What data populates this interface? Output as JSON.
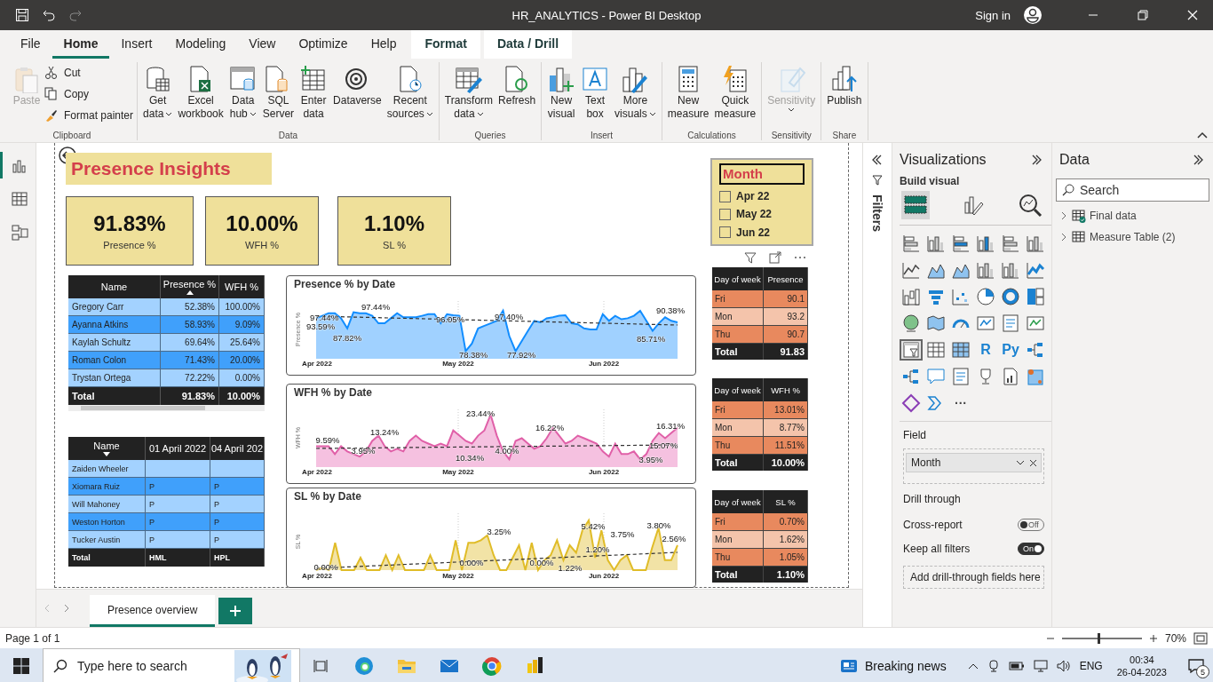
{
  "window": {
    "title": "HR_ANALYTICS - Power BI Desktop",
    "sign_in": "Sign in"
  },
  "menu_tabs": [
    {
      "label": "File",
      "selected": false,
      "contextual": false
    },
    {
      "label": "Home",
      "selected": true,
      "contextual": false
    },
    {
      "label": "Insert",
      "selected": false,
      "contextual": false
    },
    {
      "label": "Modeling",
      "selected": false,
      "contextual": false
    },
    {
      "label": "View",
      "selected": false,
      "contextual": false
    },
    {
      "label": "Optimize",
      "selected": false,
      "contextual": false
    },
    {
      "label": "Help",
      "selected": false,
      "contextual": false
    },
    {
      "label": "Format",
      "selected": false,
      "contextual": true
    },
    {
      "label": "Data / Drill",
      "selected": false,
      "contextual": true
    }
  ],
  "ribbon_groups": [
    {
      "name": "Clipboard",
      "items": [
        {
          "kind": "large",
          "lines": [
            "Paste"
          ],
          "dropdown": false,
          "disabled": true
        },
        {
          "kind": "small",
          "lines": [
            "Cut"
          ],
          "dropdown": false,
          "disabled": false
        },
        {
          "kind": "small",
          "lines": [
            "Copy"
          ],
          "dropdown": false,
          "disabled": false
        },
        {
          "kind": "small",
          "lines": [
            "Format painter"
          ],
          "dropdown": false,
          "disabled": false
        }
      ]
    },
    {
      "name": "Data",
      "items": [
        {
          "kind": "large",
          "lines": [
            "Get",
            "data"
          ],
          "dropdown": true,
          "disabled": false
        },
        {
          "kind": "large",
          "lines": [
            "Excel",
            "workbook"
          ],
          "dropdown": false,
          "disabled": false
        },
        {
          "kind": "large",
          "lines": [
            "Data",
            "hub"
          ],
          "dropdown": true,
          "disabled": false
        },
        {
          "kind": "large",
          "lines": [
            "SQL",
            "Server"
          ],
          "dropdown": false,
          "disabled": false
        },
        {
          "kind": "large",
          "lines": [
            "Enter",
            "data"
          ],
          "dropdown": false,
          "disabled": false
        },
        {
          "kind": "large",
          "lines": [
            "Dataverse"
          ],
          "dropdown": false,
          "disabled": false
        },
        {
          "kind": "large",
          "lines": [
            "Recent",
            "sources"
          ],
          "dropdown": true,
          "disabled": false
        }
      ]
    },
    {
      "name": "Queries",
      "items": [
        {
          "kind": "large",
          "lines": [
            "Transform",
            "data"
          ],
          "dropdown": true,
          "disabled": false
        },
        {
          "kind": "large",
          "lines": [
            "Refresh"
          ],
          "dropdown": false,
          "disabled": false
        }
      ]
    },
    {
      "name": "Insert",
      "items": [
        {
          "kind": "large",
          "lines": [
            "New",
            "visual"
          ],
          "dropdown": false,
          "disabled": false
        },
        {
          "kind": "large",
          "lines": [
            "Text",
            "box"
          ],
          "dropdown": false,
          "disabled": false
        },
        {
          "kind": "large",
          "lines": [
            "More",
            "visuals"
          ],
          "dropdown": true,
          "disabled": false
        }
      ]
    },
    {
      "name": "Calculations",
      "items": [
        {
          "kind": "large",
          "lines": [
            "New",
            "measure"
          ],
          "dropdown": false,
          "disabled": false
        },
        {
          "kind": "large",
          "lines": [
            "Quick",
            "measure"
          ],
          "dropdown": false,
          "disabled": false
        }
      ]
    },
    {
      "name": "Sensitivity",
      "items": [
        {
          "kind": "large",
          "lines": [
            "Sensitivity"
          ],
          "dropdown": true,
          "disabled": true
        }
      ]
    },
    {
      "name": "Share",
      "items": [
        {
          "kind": "large",
          "lines": [
            "Publish"
          ],
          "dropdown": false,
          "disabled": false
        }
      ]
    }
  ],
  "views": [
    {
      "selected": true
    },
    {
      "selected": false
    },
    {
      "selected": false
    }
  ],
  "report": {
    "title": "Presence Insights",
    "kpis": [
      {
        "value": "91.83%",
        "label": "Presence %"
      },
      {
        "value": "10.00%",
        "label": "WFH %"
      },
      {
        "value": "1.10%",
        "label": "SL %"
      }
    ],
    "name_table": {
      "sort_descending": false,
      "columns": [
        {
          "label": "Name",
          "sorted": false
        },
        {
          "label": "Presence %",
          "sorted": true
        },
        {
          "label": "WFH %",
          "sorted": false
        }
      ],
      "rows": [
        [
          "Gregory Carr",
          "52.38%",
          "100.00%"
        ],
        [
          "Ayanna Atkins",
          "58.93%",
          "9.09%"
        ],
        [
          "Kaylah Schultz",
          "69.64%",
          "25.64%"
        ],
        [
          "Roman Colon",
          "71.43%",
          "20.00%"
        ],
        [
          "Trystan Ortega",
          "72.22%",
          "0.00%"
        ]
      ],
      "total": [
        "Total",
        "91.83%",
        "10.00%"
      ]
    },
    "date_table": {
      "sort_descending": true,
      "columns": [
        {
          "label": "Name",
          "sorted": true
        },
        {
          "label": "01 April 2022",
          "sorted": false
        },
        {
          "label": "04 April 202",
          "sorted": false
        }
      ],
      "rows": [
        [
          "Zaiden Wheeler"
        ],
        [
          "Xiomara Ruiz",
          "P",
          "P"
        ],
        [
          "Will Mahoney",
          "P",
          "P"
        ],
        [
          "Weston Horton",
          "P",
          "P"
        ],
        [
          "Tucker Austin",
          "P",
          "P"
        ]
      ],
      "total": [
        "Total",
        "HML",
        "HPL"
      ]
    },
    "charts": [
      {
        "title": "Presence % by Date",
        "ylabel": "Presence %",
        "x_labels": [
          "Apr 2022",
          "May 2022",
          "Jun 2022"
        ],
        "data_labels": [
          "97.44%",
          "93.59%",
          "87.82%",
          "97.44%",
          "96.05%",
          "78.38%",
          "97.40%",
          "77.92%",
          "85.71%",
          "90.38%"
        ]
      },
      {
        "title": "WFH % by Date",
        "ylabel": "WFH %",
        "x_labels": [
          "Apr 2022",
          "May 2022",
          "Jun 2022"
        ],
        "data_labels": [
          "9.59%",
          "3.95%",
          "13.24%",
          "23.44%",
          "10.34%",
          "4.00%",
          "16.22%",
          "16.31%",
          "15.07%",
          "3.95%"
        ]
      },
      {
        "title": "SL % by Date",
        "ylabel": "SL %",
        "x_labels": [
          "Apr 2022",
          "May 2022",
          "Jun 2022"
        ],
        "data_labels": [
          "0.00%",
          "3.25%",
          "0.00%",
          "0.00%",
          "5.42%",
          "1.20%",
          "1.22%",
          "3.75%",
          "3.80%",
          "2.56%"
        ]
      }
    ],
    "slicer": {
      "title": "Month",
      "items": [
        {
          "label": "Apr 22",
          "checked": false
        },
        {
          "label": "May 22",
          "checked": false
        },
        {
          "label": "Jun 22",
          "checked": false
        }
      ]
    },
    "day_tables": [
      {
        "columns": [
          "Day of week",
          "Presence"
        ],
        "rows": [
          [
            "Fri",
            "90.1"
          ],
          [
            "Mon",
            "93.2"
          ],
          [
            "Thu",
            "90.7"
          ]
        ],
        "total": [
          "Total",
          "91.83"
        ]
      },
      {
        "columns": [
          "Day of week",
          "WFH %"
        ],
        "rows": [
          [
            "Fri",
            "13.01%"
          ],
          [
            "Mon",
            "8.77%"
          ],
          [
            "Thu",
            "11.51%"
          ]
        ],
        "total": [
          "Total",
          "10.00%"
        ]
      },
      {
        "columns": [
          "Day of week",
          "SL %"
        ],
        "rows": [
          [
            "Fri",
            "0.70%"
          ],
          [
            "Mon",
            "1.62%"
          ],
          [
            "Thu",
            "1.05%"
          ]
        ],
        "total": [
          "Total",
          "1.10%"
        ]
      }
    ]
  },
  "filters": {
    "label": "Filters"
  },
  "visualizations": {
    "title": "Visualizations",
    "subtitle": "Build visual",
    "build_tabs": [
      {
        "selected": true
      },
      {
        "selected": false
      },
      {
        "selected": false
      }
    ],
    "visual_types": [
      {
        "kind": "stacked-bar",
        "selected": false
      },
      {
        "kind": "stacked-column",
        "selected": false
      },
      {
        "kind": "clustered-bar",
        "selected": false
      },
      {
        "kind": "clustered-column",
        "selected": false
      },
      {
        "kind": "percent-bar",
        "selected": false
      },
      {
        "kind": "percent-column",
        "selected": false
      },
      {
        "kind": "line",
        "selected": false
      },
      {
        "kind": "area",
        "selected": false
      },
      {
        "kind": "stacked-area",
        "selected": false
      },
      {
        "kind": "line-column",
        "selected": false
      },
      {
        "kind": "line-column",
        "selected": false
      },
      {
        "kind": "ribbon",
        "selected": false
      },
      {
        "kind": "waterfall",
        "selected": false
      },
      {
        "kind": "funnel",
        "selected": false
      },
      {
        "kind": "scatter",
        "selected": false
      },
      {
        "kind": "pie",
        "selected": false
      },
      {
        "kind": "donut",
        "selected": false
      },
      {
        "kind": "treemap",
        "selected": false
      },
      {
        "kind": "globe",
        "selected": false
      },
      {
        "kind": "filled-map",
        "selected": false
      },
      {
        "kind": "gauge",
        "selected": false
      },
      {
        "kind": "card",
        "selected": false
      },
      {
        "kind": "multi-card",
        "selected": false
      },
      {
        "kind": "kpi",
        "selected": false
      },
      {
        "kind": "slicer",
        "selected": true
      },
      {
        "kind": "table",
        "selected": false
      },
      {
        "kind": "matrix",
        "selected": false
      },
      {
        "kind": "text",
        "label": "R",
        "selected": false
      },
      {
        "kind": "text",
        "label": "Py",
        "selected": false
      },
      {
        "kind": "influencers",
        "selected": false
      },
      {
        "kind": "decomposition",
        "selected": false
      },
      {
        "kind": "speech",
        "selected": false
      },
      {
        "kind": "narrative",
        "selected": false
      },
      {
        "kind": "trophy",
        "selected": false
      },
      {
        "kind": "paginated",
        "selected": false
      },
      {
        "kind": "map-pin",
        "selected": false
      },
      {
        "kind": "diamond",
        "selected": false
      },
      {
        "kind": "chevrons",
        "selected": false
      },
      {
        "kind": "more",
        "label": "···",
        "selected": false
      }
    ],
    "field_label": "Field",
    "field_value": "Month",
    "drill_title": "Drill through",
    "toggles": [
      {
        "label": "Cross-report",
        "on": false,
        "state_text": "Off"
      },
      {
        "label": "Keep all filters",
        "on": true,
        "state_text": "On"
      }
    ],
    "drop_hint": "Add drill-through fields here"
  },
  "data_pane": {
    "title": "Data",
    "search": {
      "placeholder": "Search"
    },
    "tables": [
      {
        "label": "Final data",
        "expanded": false,
        "checked": true
      },
      {
        "label": "Measure Table (2)",
        "expanded": false,
        "checked": false
      }
    ]
  },
  "page_tabs": [
    {
      "label": "Presence overview",
      "selected": true
    }
  ],
  "status_bar": {
    "page": "Page 1 of 1",
    "zoom": {
      "reading": "70%",
      "level": 0.45
    }
  },
  "taskbar": {
    "search": {
      "placeholder": "Type here to search"
    },
    "news": "Breaking news",
    "language": "ENG",
    "time": "00:34",
    "date": "26-04-2023",
    "notifications": "5"
  }
}
